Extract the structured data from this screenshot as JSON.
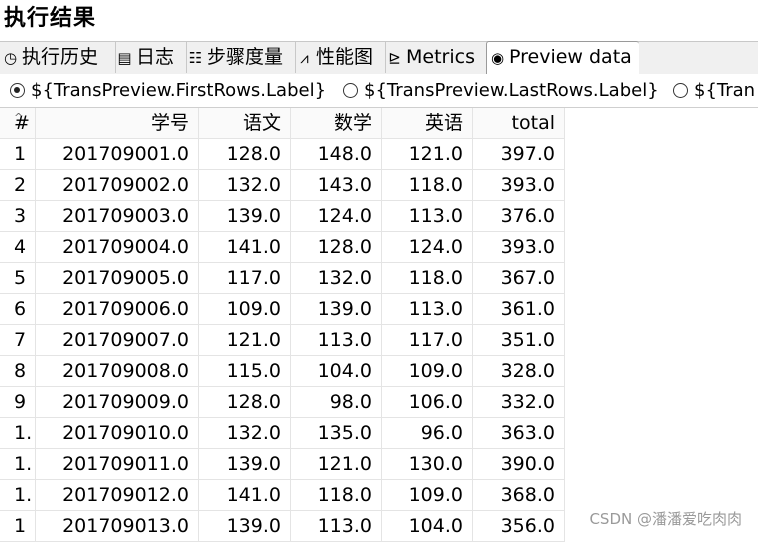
{
  "panel_title": "执行结果",
  "tabs": [
    {
      "label": "执行历史",
      "icon": "history-icon"
    },
    {
      "label": "日志",
      "icon": "log-icon"
    },
    {
      "label": "步骤度量",
      "icon": "step-metrics-icon"
    },
    {
      "label": "性能图",
      "icon": "performance-chart-icon"
    },
    {
      "label": "Metrics",
      "icon": "metrics-icon"
    },
    {
      "label": "Preview data",
      "icon": "preview-eye-icon"
    }
  ],
  "active_tab": "Preview data",
  "radio_options": [
    {
      "label": "${TransPreview.FirstRows.Label}",
      "selected": true
    },
    {
      "label": "${TransPreview.LastRows.Label}",
      "selected": false
    },
    {
      "label": "${Tran",
      "selected": false
    }
  ],
  "table": {
    "columns": [
      "#",
      "学号",
      "语文",
      "数学",
      "英语",
      "total"
    ],
    "rows": [
      [
        "1",
        "201709001.0",
        "128.0",
        "148.0",
        "121.0",
        "397.0"
      ],
      [
        "2",
        "201709002.0",
        "132.0",
        "143.0",
        "118.0",
        "393.0"
      ],
      [
        "3",
        "201709003.0",
        "139.0",
        "124.0",
        "113.0",
        "376.0"
      ],
      [
        "4",
        "201709004.0",
        "141.0",
        "128.0",
        "124.0",
        "393.0"
      ],
      [
        "5",
        "201709005.0",
        "117.0",
        "132.0",
        "118.0",
        "367.0"
      ],
      [
        "6",
        "201709006.0",
        "109.0",
        "139.0",
        "113.0",
        "361.0"
      ],
      [
        "7",
        "201709007.0",
        "121.0",
        "113.0",
        "117.0",
        "351.0"
      ],
      [
        "8",
        "201709008.0",
        "115.0",
        "104.0",
        "109.0",
        "328.0"
      ],
      [
        "9",
        "201709009.0",
        "128.0",
        "98.0",
        "106.0",
        "332.0"
      ],
      [
        "1.",
        "201709010.0",
        "132.0",
        "135.0",
        "96.0",
        "363.0"
      ],
      [
        "1.",
        "201709011.0",
        "139.0",
        "121.0",
        "130.0",
        "390.0"
      ],
      [
        "1.",
        "201709012.0",
        "141.0",
        "118.0",
        "109.0",
        "368.0"
      ],
      [
        "1",
        "201709013.0",
        "139.0",
        "113.0",
        "104.0",
        "356.0"
      ]
    ]
  },
  "watermark": "CSDN @潘潘爱吃肉肉"
}
